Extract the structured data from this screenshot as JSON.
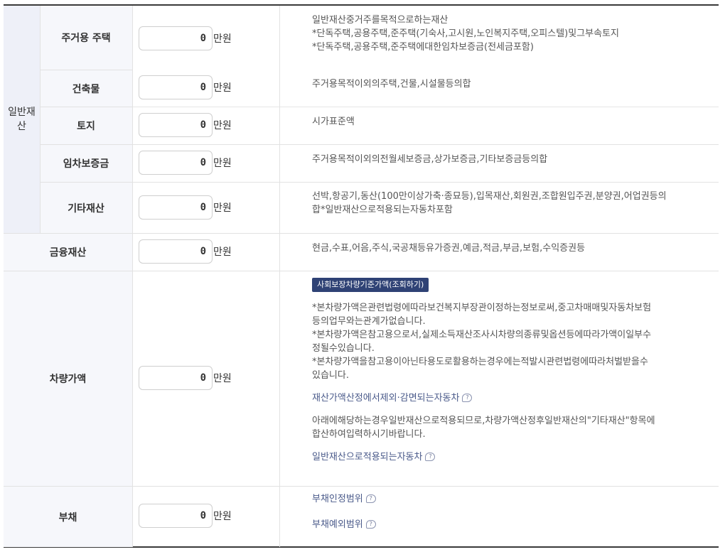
{
  "unit": "만원",
  "general_category": "일반재산",
  "rows": [
    {
      "label": "주거용 주택",
      "value": "0",
      "desc": [
        "일반재산중거주를목적으로하는재산",
        "*단독주택,공용주택,준주택(기숙사,고시원,노인복지주택,오피스텔)및그부속토지",
        "*단독주택,공용주택,준주택에대한임차보증금(전세금포함)"
      ]
    },
    {
      "label": "건축물",
      "value": "0",
      "desc": [
        "주거용목적이외의주택,건물,시설물등의합"
      ]
    },
    {
      "label": "토지",
      "value": "0",
      "desc": [
        "시가표준액"
      ]
    },
    {
      "label": "임차보증금",
      "value": "0",
      "desc": [
        "주거용목적이외의전월세보증금,상가보증금,기타보증금등의합"
      ]
    },
    {
      "label": "기타재산",
      "value": "0",
      "desc": [
        "선박,항공기,동산(100만이상가축·종묘등),입목재산,회원권,조합원입주권,분양권,어업권등의",
        "합*일반재산으로적용되는자동차포함"
      ]
    },
    {
      "label": "금융재산",
      "value": "0",
      "desc": [
        "현금,수표,어음,주식,국공채등유가증권,예금,적금,부금,보험,수익증권등"
      ]
    }
  ],
  "vehicle": {
    "label": "차량가액",
    "value": "0",
    "button": "사회보장차량기준가액(조회하기)",
    "notes": [
      "*본차량가액은관련법령에따라보건복지부장관이정하는정보로써,중고차매매및자동차보험",
      "등의업무와는관계가없습니다.",
      "*본차량가액은참고용으로서,실제소득재산조사시차량의종류및옵션등에따라가액이일부수",
      "정될수있습니다.",
      "*본차량가액을참고용이아닌타용도로활용하는경우에는적발시관련법령에따라처벌받을수",
      "있습니다."
    ],
    "link1": "재산가액산정에서제외·감면되는자동차",
    "info": [
      "아래에해당하는경우일반재산으로적용되므로,차량가액산정후일반재산의\"기타재산\"항목에",
      "합산하여입력하시기바랍니다."
    ],
    "link2": "일반재산으로적용되는자동차"
  },
  "debt": {
    "label": "부채",
    "value": "0",
    "link1": "부채인정범위",
    "link2": "부채예외범위"
  },
  "help_icon_glyph": "?"
}
